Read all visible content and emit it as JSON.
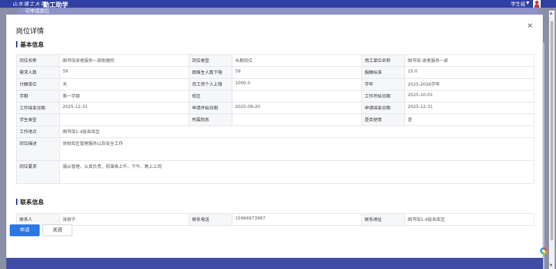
{
  "app": {
    "logo_script": "山东理工大学",
    "title": "勤工助学",
    "user_role": "学生组",
    "subtab": "可申请岗位"
  },
  "modal": {
    "title": "岗位详情",
    "close_icon": "×",
    "basic_section": "基本信息",
    "basic_rows": [
      [
        {
          "k": "岗位名称",
          "v": "图书馆读者服务一部助理岗"
        },
        {
          "k": "岗位类型",
          "v": "长期岗位"
        },
        {
          "k": "用工单位名称",
          "v": "图书馆-读者服务一部"
        }
      ],
      [
        {
          "k": "需求人数",
          "v": "59"
        },
        {
          "k": "困难生人数下限",
          "v": "59"
        },
        {
          "k": "报酬标准",
          "v": "15.0"
        }
      ],
      [
        {
          "k": "计酬单位",
          "v": "天"
        },
        {
          "k": "月工资个人上限",
          "v": "1000.0"
        },
        {
          "k": "学年",
          "v": "2025-2026学年"
        }
      ],
      [
        {
          "k": "学期",
          "v": "第一学期"
        },
        {
          "k": "校区",
          "v": ""
        },
        {
          "k": "工作开始日期",
          "v": "2025-10-01"
        }
      ],
      [
        {
          "k": "工作结束日期",
          "v": "2025-12-31"
        },
        {
          "k": "申请开始日期",
          "v": "2025-09-20"
        },
        {
          "k": "申请结束日期",
          "v": "2025-12-31"
        }
      ],
      [
        {
          "k": "学生类型",
          "v": ""
        },
        {
          "k": "所属院系",
          "v": ""
        },
        {
          "k": "是否使用",
          "v": "是"
        }
      ]
    ],
    "location": {
      "k": "工作地点",
      "v": "图书馆1-4层各库区"
    },
    "description": {
      "k": "岗位描述",
      "v": "协助库区管理服务以及安全工作"
    },
    "requirements": {
      "k": "岗位要求",
      "v": "服从管理、认真负责，视课表上午、下午、晚上上岗"
    },
    "contact_section": "联系信息",
    "contact_row": [
      {
        "k": "联系人",
        "v": "张朋宁"
      },
      {
        "k": "联系电话",
        "v": "15966973997"
      },
      {
        "k": "联系地址",
        "v": "图书馆1-4层各库区"
      }
    ],
    "apply_button": "申请",
    "close_button": "关闭"
  },
  "colors": {
    "brand": "#2f3fa3",
    "primary_button": "#2b78e4"
  },
  "icons": {
    "avatar": "user-avatar-icon",
    "caret": "chevron-down-icon",
    "close": "close-icon",
    "float": "floating-assistant-icon"
  }
}
